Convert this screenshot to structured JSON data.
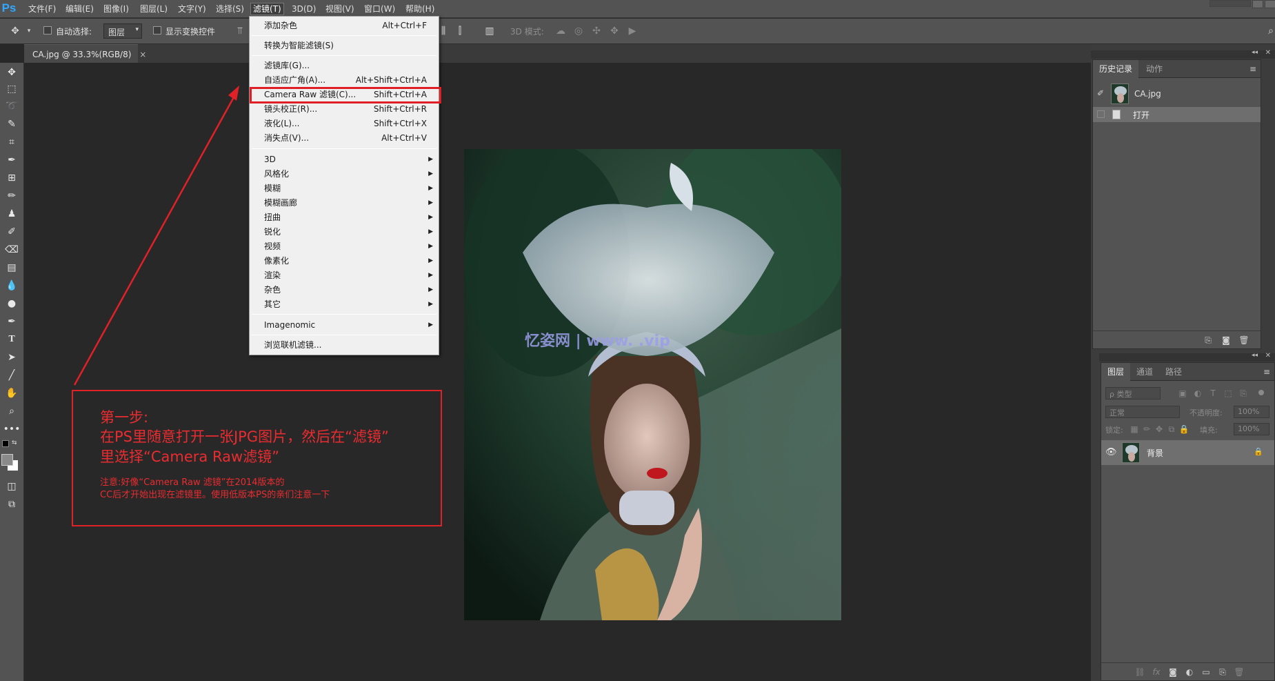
{
  "app": {
    "logo": "Ps"
  },
  "menubar": {
    "items": [
      "文件(F)",
      "编辑(E)",
      "图像(I)",
      "图层(L)",
      "文字(Y)",
      "选择(S)",
      "滤镜(T)",
      "3D(D)",
      "视图(V)",
      "窗口(W)",
      "帮助(H)"
    ],
    "active_index": 6
  },
  "options_bar": {
    "auto_select_label": "自动选择:",
    "auto_select_value": "图层",
    "show_transform_label": "显示变换控件",
    "mode_3d_label": "3D 模式:"
  },
  "document_tab": {
    "title": "CA.jpg @ 33.3%(RGB/8)",
    "close": "×"
  },
  "filter_menu": {
    "items": [
      {
        "label": "添加杂色",
        "shortcut": "Alt+Ctrl+F"
      },
      {
        "label": "转换为智能滤镜(S)",
        "shortcut": ""
      },
      {
        "label": "滤镜库(G)...",
        "shortcut": ""
      },
      {
        "label": "自适应广角(A)...",
        "shortcut": "Alt+Shift+Ctrl+A"
      },
      {
        "label": "Camera Raw 滤镜(C)...",
        "shortcut": "Shift+Ctrl+A"
      },
      {
        "label": "镜头校正(R)...",
        "shortcut": "Shift+Ctrl+R"
      },
      {
        "label": "液化(L)...",
        "shortcut": "Shift+Ctrl+X"
      },
      {
        "label": "消失点(V)...",
        "shortcut": "Alt+Ctrl+V"
      },
      {
        "label": "3D",
        "shortcut": ""
      },
      {
        "label": "风格化",
        "shortcut": ""
      },
      {
        "label": "模糊",
        "shortcut": ""
      },
      {
        "label": "模糊画廊",
        "shortcut": ""
      },
      {
        "label": "扭曲",
        "shortcut": ""
      },
      {
        "label": "锐化",
        "shortcut": ""
      },
      {
        "label": "视频",
        "shortcut": ""
      },
      {
        "label": "像素化",
        "shortcut": ""
      },
      {
        "label": "渲染",
        "shortcut": ""
      },
      {
        "label": "杂色",
        "shortcut": ""
      },
      {
        "label": "其它",
        "shortcut": ""
      },
      {
        "label": "Imagenomic",
        "shortcut": ""
      },
      {
        "label": "浏览联机滤镜...",
        "shortcut": ""
      }
    ],
    "highlighted_item": "Camera Raw 滤镜(C)..."
  },
  "annotation": {
    "line1": "第一步:",
    "line2": "在PS里随意打开一张JPG图片，然后在“滤镜”",
    "line3": "里选择“Camera Raw滤镜”",
    "note1": "注意:好像“Camera Raw 滤镜”在2014版本的",
    "note2": "CC后才开始出现在滤镜里。使用低版本PS的亲们注意一下",
    "color": "#ea2c30"
  },
  "watermark": "忆姿网 | www.    .vip",
  "history_panel": {
    "tabs": [
      "历史记录",
      "动作"
    ],
    "snapshot_label": "CA.jpg",
    "steps": [
      "打开"
    ]
  },
  "layers_panel": {
    "tabs": [
      "图层",
      "通道",
      "路径"
    ],
    "filter_placeholder": "ρ 类型",
    "blend_mode": "正常",
    "opacity_label": "不透明度:",
    "opacity_value": "100%",
    "lock_label": "锁定:",
    "fill_label": "填充:",
    "fill_value": "100%",
    "layers": [
      {
        "name": "背景",
        "locked": true,
        "visible": true
      }
    ],
    "footer_fx": "fx"
  },
  "colors": {
    "ui_panel": "#535353",
    "canvas_bg": "#282828",
    "highlight_red": "#e01e26",
    "ps_blue": "#31a8ff"
  }
}
